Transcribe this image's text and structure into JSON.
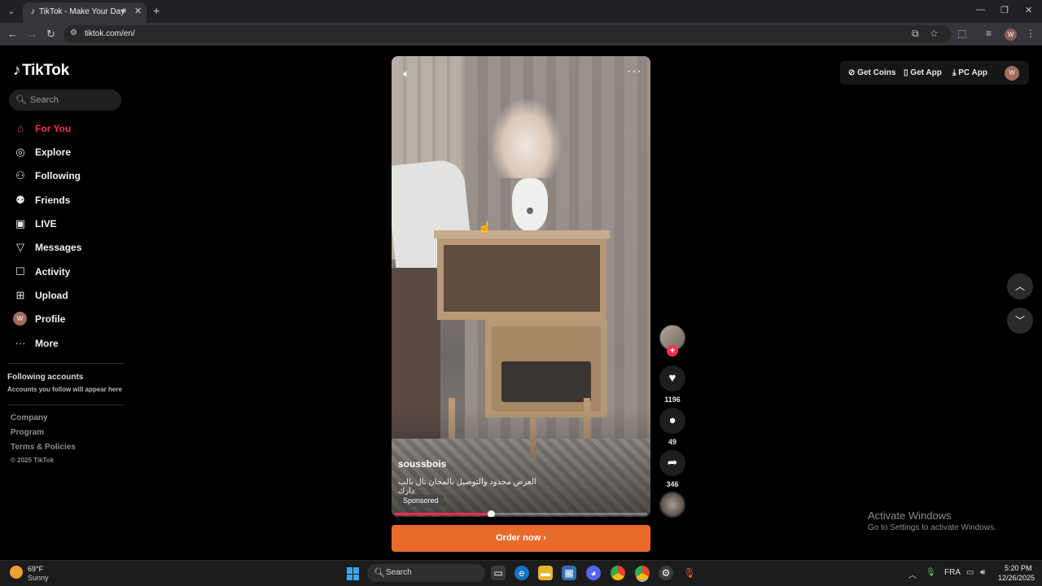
{
  "browser": {
    "tab_title": "TikTok - Make Your Day",
    "url": "tiktok.com/en/",
    "profile_initial": "W"
  },
  "tiktok": {
    "logo_text": "TikTok",
    "search_placeholder": "Search",
    "nav": [
      {
        "label": "For You",
        "icon": "home-icon",
        "active": true
      },
      {
        "label": "Explore",
        "icon": "compass-icon"
      },
      {
        "label": "Following",
        "icon": "following-icon"
      },
      {
        "label": "Friends",
        "icon": "friends-icon"
      },
      {
        "label": "LIVE",
        "icon": "live-icon"
      },
      {
        "label": "Messages",
        "icon": "messages-icon"
      },
      {
        "label": "Activity",
        "icon": "activity-icon"
      },
      {
        "label": "Upload",
        "icon": "upload-icon"
      },
      {
        "label": "Profile",
        "icon": "profile-avatar",
        "initial": "W"
      },
      {
        "label": "More",
        "icon": "more-icon"
      }
    ],
    "following_accounts": {
      "title": "Following accounts",
      "subtitle": "Accounts you follow will appear here"
    },
    "footer_links": [
      "Company",
      "Program",
      "Terms & Policies"
    ],
    "copyright": "© 2025 TikTok",
    "top_actions": {
      "coins": "Get Coins",
      "app": "Get App",
      "pc_app": "PC App",
      "avatar_initial": "W"
    },
    "video": {
      "author": "soussbois",
      "description": "العرض محدود والتوصيل بالمجان نال بالب دارك",
      "sponsored_label": "Sponsored",
      "progress": 0.38
    },
    "cta_label": "Order now",
    "stats": {
      "likes": "1196",
      "comments": "49",
      "shares": "346"
    }
  },
  "windows": {
    "activate_title": "Activate Windows",
    "activate_sub": "Go to Settings to activate Windows.",
    "weather_temp": "69°F",
    "weather_cond": "Sunny",
    "taskbar_search": "Search",
    "language": "FRA",
    "time": "5:20 PM",
    "date": "12/26/2025"
  }
}
